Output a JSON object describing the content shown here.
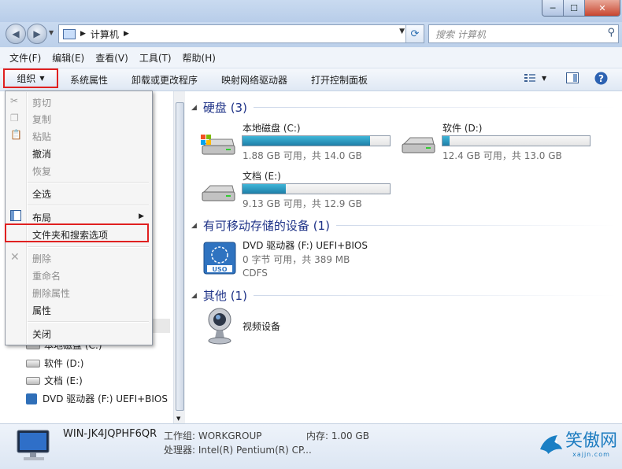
{
  "window": {
    "min": "─",
    "max": "☐",
    "close": "✕"
  },
  "address": {
    "location": "计算机",
    "search_placeholder": "搜索 计算机"
  },
  "menubar": [
    "文件(F)",
    "编辑(E)",
    "查看(V)",
    "工具(T)",
    "帮助(H)"
  ],
  "toolbar": {
    "organize": "组织",
    "items": [
      "系统属性",
      "卸载或更改程序",
      "映射网络驱动器",
      "打开控制面板"
    ]
  },
  "context_menu": {
    "cut": "剪切",
    "copy": "复制",
    "paste": "粘贴",
    "undo": "撤消",
    "redo": "恢复",
    "select_all": "全选",
    "layout": "布局",
    "folder_options": "文件夹和搜索选项",
    "delete": "删除",
    "rename": "重命名",
    "remove_properties": "删除属性",
    "properties": "属性",
    "close": "关闭"
  },
  "tree": [
    {
      "label": "本地磁盘 (C:)"
    },
    {
      "label": "软件 (D:)"
    },
    {
      "label": "文档 (E:)"
    },
    {
      "label": "DVD 驱动器 (F:) UEFI+BIOS"
    }
  ],
  "groups": {
    "hard_disk": "硬盘 (3)",
    "removable": "有可移动存储的设备 (1)",
    "other": "其他 (1)"
  },
  "drives": [
    {
      "name": "本地磁盘 (C:)",
      "info": "1.88 GB 可用，共 14.0 GB",
      "used": 0.866
    },
    {
      "name": "软件 (D:)",
      "info": "12.4 GB 可用，共 13.0 GB",
      "used": 0.046
    },
    {
      "name": "文档 (E:)",
      "info": "9.13 GB 可用，共 12.9 GB",
      "used": 0.292
    }
  ],
  "dvd": {
    "name": "DVD 驱动器 (F:) UEFI+BIOS",
    "info": "0 字节 可用，共 389 MB",
    "fs": "CDFS",
    "icon_text": "USO"
  },
  "other": {
    "name": "视频设备"
  },
  "status": {
    "computer": "WIN-JK4JQPHF6QR",
    "workgroup": "工作组: WORKGROUP",
    "memory": "内存: 1.00 GB",
    "cpu": "处理器: Intel(R) Pentium(R) CP..."
  },
  "watermark": {
    "text": "笑傲网",
    "url": "xajjn.com"
  }
}
